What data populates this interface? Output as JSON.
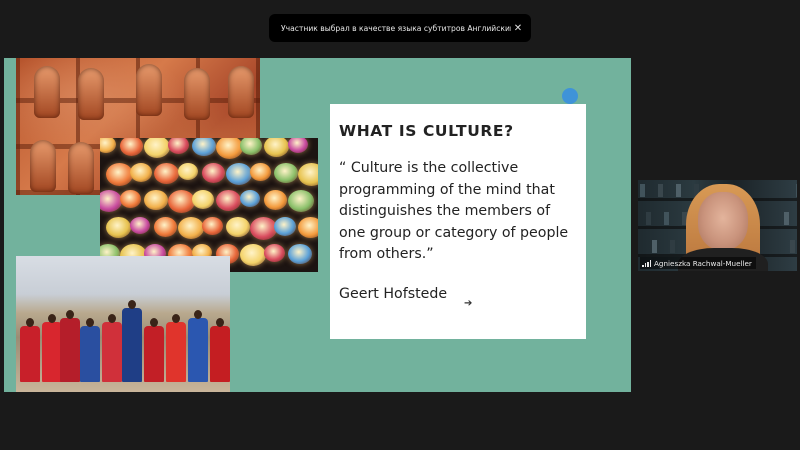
{
  "notification": {
    "text": "Участник выбрал в качестве языка субтитров Английский.",
    "close_glyph": "✕"
  },
  "slide": {
    "background_color": "#72b29d",
    "images": [
      {
        "name": "temple-carving-photo",
        "description_icon": "image"
      },
      {
        "name": "lanterns-photo",
        "description_icon": "image"
      },
      {
        "name": "masai-group-photo",
        "description_icon": "image"
      }
    ],
    "card": {
      "title": "WHAT IS CULTURE?",
      "quote": "“ Culture is the collective programming of the mind that distinguishes the members of one group or category of people from others.”",
      "author": "Geert Hofstede"
    },
    "accent_dot_color": "#3f93d8",
    "cursor_glyph": "➔"
  },
  "participant": {
    "name": "Agnieszka Rachwal-Mueller",
    "icon": "signal-bars-icon"
  }
}
